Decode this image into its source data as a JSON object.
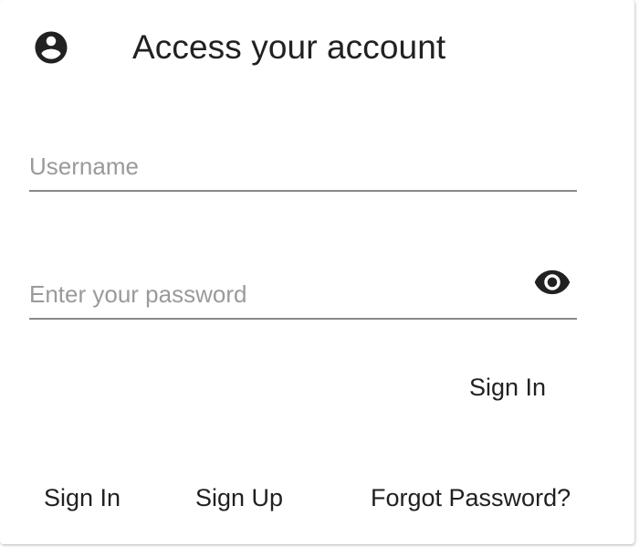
{
  "header": {
    "icon": "account-circle-icon",
    "title": "Access your account"
  },
  "form": {
    "username": {
      "placeholder": "Username",
      "value": ""
    },
    "password": {
      "placeholder": "Enter your password",
      "value": ""
    },
    "visibility_icon": "eye-icon",
    "submit_label": "Sign In"
  },
  "footer": {
    "links": [
      {
        "label": "Sign In"
      },
      {
        "label": "Sign Up"
      },
      {
        "label": "Forgot Password?"
      }
    ]
  },
  "colors": {
    "text": "#212121",
    "placeholder": "#9a9a9a",
    "underline": "#8a8a8a"
  }
}
